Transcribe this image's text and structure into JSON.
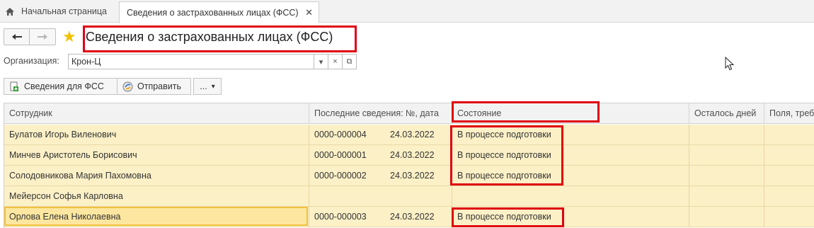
{
  "tabs": {
    "home_label": "Начальная страница",
    "active_label": "Сведения о застрахованных лицах (ФСС)",
    "close_glyph": "✕"
  },
  "title_bar": {
    "back_glyph": "🡐",
    "forward_glyph": "🡒",
    "star_glyph": "★",
    "title": "Сведения о застрахованных лицах (ФСС)"
  },
  "filters": {
    "organization_label": "Организация:",
    "organization_value": "Крон-Ц",
    "dropdown_glyph": "▾",
    "clear_glyph": "×",
    "open_glyph": "⧉"
  },
  "toolbar": {
    "info_button": "Сведения для ФСС",
    "send_button": "Отправить",
    "more_button": "...",
    "more_arrow": "▾"
  },
  "table": {
    "columns": [
      "Сотрудник",
      "Последние сведения: №, дата",
      "Состояние",
      "Осталось дней",
      "Поля, треб"
    ],
    "rows": [
      {
        "employee": "Булатов Игорь Виленович",
        "number": "0000-000004",
        "date": "24.03.2022",
        "status": "В процессе подготовки",
        "days": "",
        "fields": ""
      },
      {
        "employee": "Минчев Аристотель Борисович",
        "number": "0000-000001",
        "date": "24.03.2022",
        "status": "В процессе подготовки",
        "days": "",
        "fields": ""
      },
      {
        "employee": "Солодовникова Мария Пахомовна",
        "number": "0000-000002",
        "date": "24.03.2022",
        "status": "В процессе подготовки",
        "days": "",
        "fields": ""
      },
      {
        "employee": "Мейерсон Софья Карловна",
        "number": "",
        "date": "",
        "status": "",
        "days": "",
        "fields": ""
      },
      {
        "employee": "Орлова Елена Николаевна",
        "number": "0000-000003",
        "date": "24.03.2022",
        "status": "В процессе подготовки",
        "days": "",
        "fields": ""
      }
    ],
    "selected_row_index": 4
  },
  "colors": {
    "highlight_red": "#e00010",
    "row_yellow": "#fbf0c6",
    "selected_border": "#f0c040",
    "star_gold": "#f2c200"
  }
}
